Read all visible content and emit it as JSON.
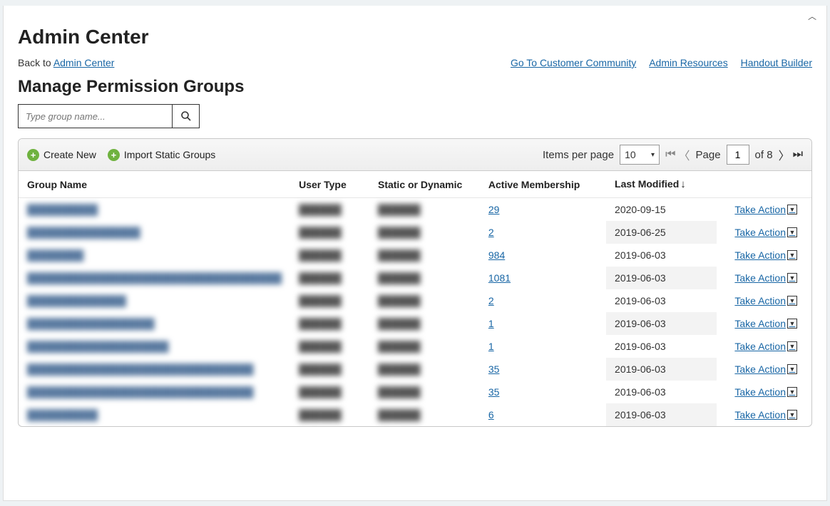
{
  "header": {
    "title": "Admin Center",
    "back_prefix": "Back to ",
    "back_link": "Admin Center"
  },
  "top_links": {
    "community": "Go To Customer Community",
    "resources": "Admin Resources",
    "handout": "Handout Builder"
  },
  "section": {
    "title": "Manage Permission Groups"
  },
  "search": {
    "placeholder": "Type group name..."
  },
  "toolbar": {
    "create_new": "Create New",
    "import_static": "Import Static Groups",
    "items_per_page_label": "Items per page",
    "items_per_page_value": "10",
    "page_label": "Page",
    "page_value": "1",
    "page_of_label": "of 8"
  },
  "columns": {
    "group_name": "Group Name",
    "user_type": "User Type",
    "static_dynamic": "Static or Dynamic",
    "active_membership": "Active Membership",
    "last_modified": "Last Modified"
  },
  "take_action_label": "Take Action",
  "rows": [
    {
      "group_name": "██████████",
      "user_type": "██████",
      "static_dynamic": "██████",
      "membership": "29",
      "last_modified": "2020-09-15"
    },
    {
      "group_name": "████████████████",
      "user_type": "██████",
      "static_dynamic": "██████",
      "membership": "2",
      "last_modified": "2019-06-25"
    },
    {
      "group_name": "████████",
      "user_type": "██████",
      "static_dynamic": "██████",
      "membership": "984",
      "last_modified": "2019-06-03"
    },
    {
      "group_name": "████████████████████████████████████",
      "user_type": "██████",
      "static_dynamic": "██████",
      "membership": "1081",
      "last_modified": "2019-06-03"
    },
    {
      "group_name": "██████████████",
      "user_type": "██████",
      "static_dynamic": "██████",
      "membership": "2",
      "last_modified": "2019-06-03"
    },
    {
      "group_name": "██████████████████",
      "user_type": "██████",
      "static_dynamic": "██████",
      "membership": "1",
      "last_modified": "2019-06-03"
    },
    {
      "group_name": "████████████████████",
      "user_type": "██████",
      "static_dynamic": "██████",
      "membership": "1",
      "last_modified": "2019-06-03"
    },
    {
      "group_name": "████████████████████████████████",
      "user_type": "██████",
      "static_dynamic": "██████",
      "membership": "35",
      "last_modified": "2019-06-03"
    },
    {
      "group_name": "████████████████████████████████",
      "user_type": "██████",
      "static_dynamic": "██████",
      "membership": "35",
      "last_modified": "2019-06-03"
    },
    {
      "group_name": "██████████",
      "user_type": "██████",
      "static_dynamic": "██████",
      "membership": "6",
      "last_modified": "2019-06-03"
    }
  ]
}
